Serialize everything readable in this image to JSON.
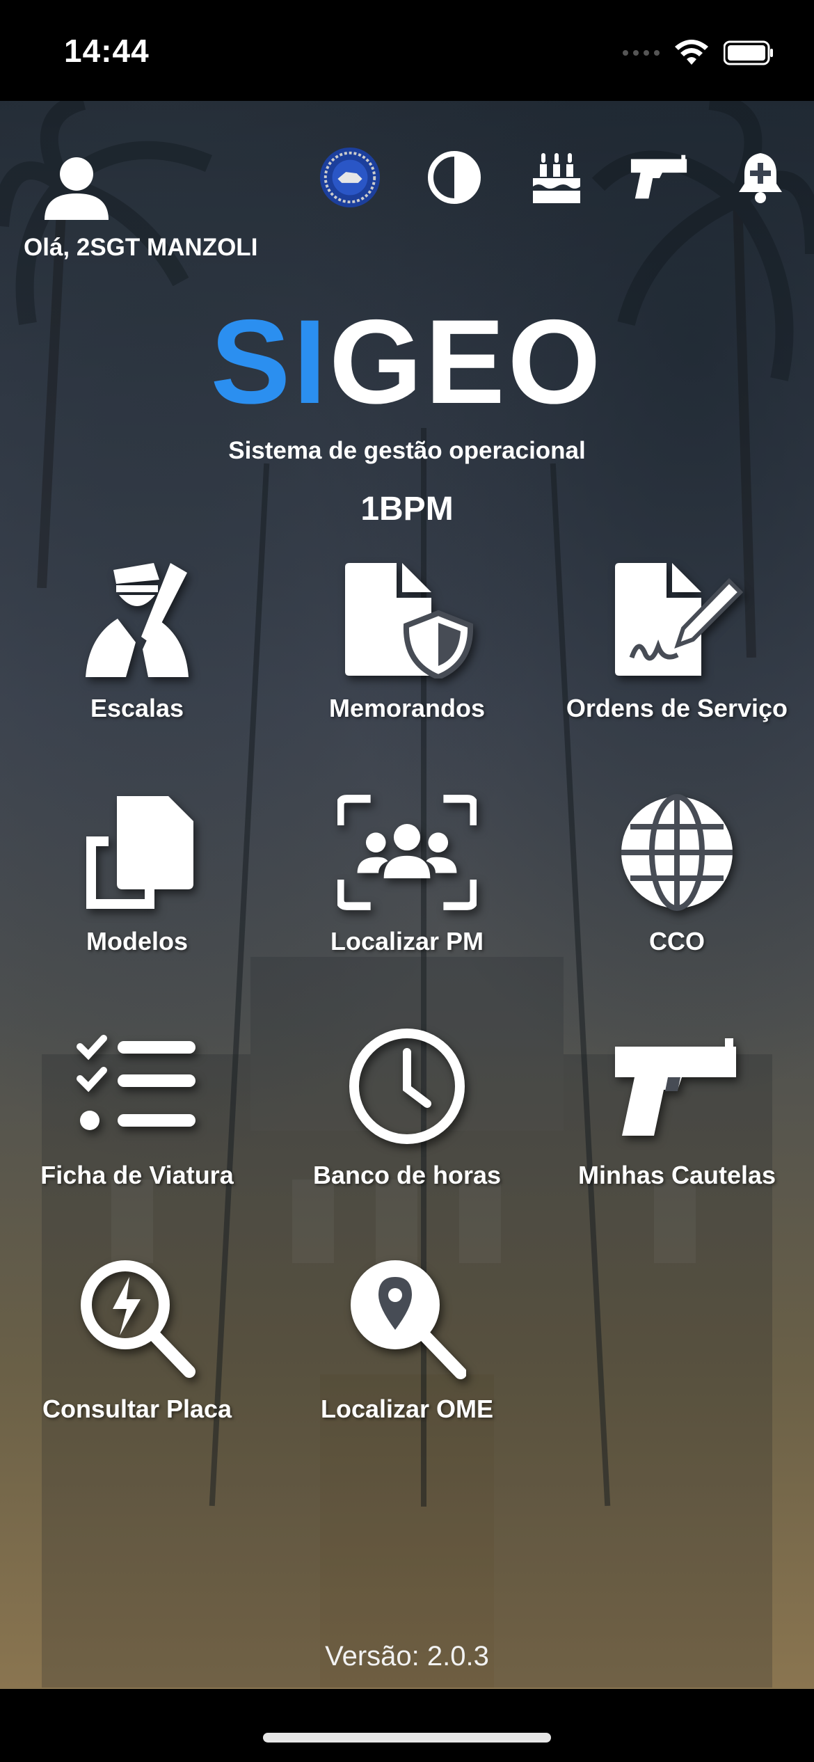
{
  "status_bar": {
    "time": "14:44"
  },
  "header": {
    "greeting": "Olá, 2SGT MANZOLI"
  },
  "top_actions": [
    {
      "icon": "unit-emblem-icon"
    },
    {
      "icon": "contrast-icon"
    },
    {
      "icon": "birthday-cake-icon"
    },
    {
      "icon": "pistol-icon"
    },
    {
      "icon": "bell-plus-icon"
    }
  ],
  "brand": {
    "logo_part1": "SI",
    "logo_part2": "GEO",
    "subtitle": "Sistema de gestão operacional",
    "unit": "1BPM",
    "accent_color": "#2b8ff0"
  },
  "menu": [
    {
      "label": "Escalas",
      "icon": "officer-icon"
    },
    {
      "label": "Memorandos",
      "icon": "document-shield-icon"
    },
    {
      "label": "Ordens de Serviço",
      "icon": "document-sign-icon"
    },
    {
      "label": "Modelos",
      "icon": "copy-icon"
    },
    {
      "label": "Localizar PM",
      "icon": "group-focus-icon"
    },
    {
      "label": "CCO",
      "icon": "globe-icon"
    },
    {
      "label": "Ficha de Viatura",
      "icon": "checklist-icon"
    },
    {
      "label": "Banco de horas",
      "icon": "clock-icon"
    },
    {
      "label": "Minhas Cautelas",
      "icon": "pistol-icon"
    },
    {
      "label": "Consultar Placa",
      "icon": "lightning-search-icon"
    },
    {
      "label": "Localizar OME",
      "icon": "location-search-icon"
    }
  ],
  "footer": {
    "version": "Versão: 2.0.3"
  }
}
